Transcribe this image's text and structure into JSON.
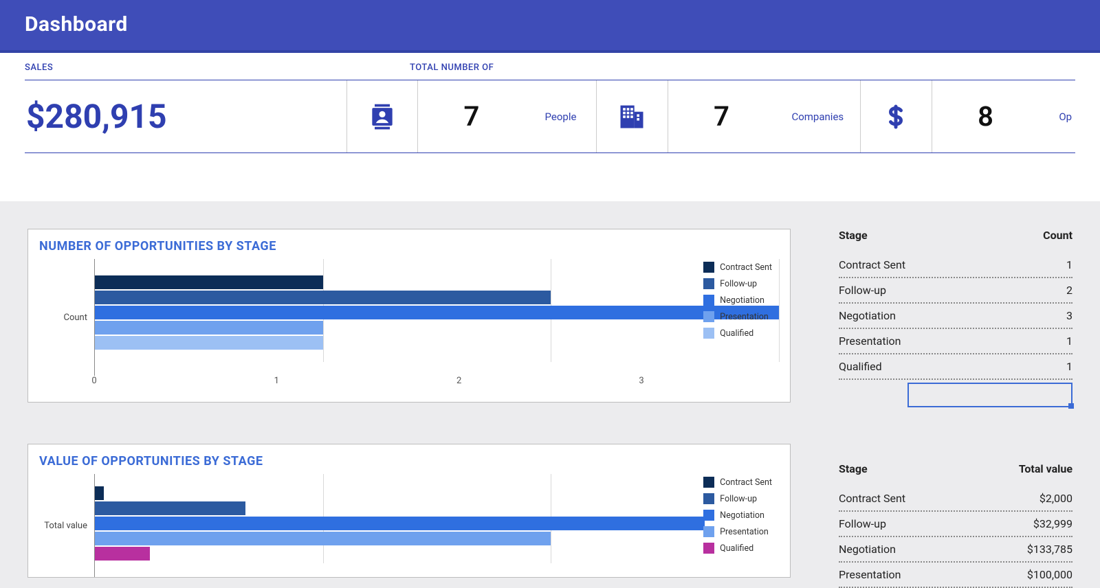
{
  "appbar": {
    "title": "Dashboard"
  },
  "summary": {
    "sales_label": "SALES",
    "total_label": "TOTAL NUMBER OF",
    "sales_value": "$280,915",
    "stats": [
      {
        "icon": "person-badge-icon",
        "value": "7",
        "label": "People"
      },
      {
        "icon": "building-icon",
        "value": "7",
        "label": "Companies"
      },
      {
        "icon": "dollar-icon",
        "value": "8",
        "label": "Op"
      }
    ]
  },
  "charts": {
    "opp_count": {
      "title": "NUMBER OF OPPORTUNITIES BY STAGE",
      "ylabel": "Count",
      "ticks": [
        "0",
        "1",
        "2",
        "3"
      ]
    },
    "opp_value": {
      "title": "VALUE OF OPPORTUNITIES BY STAGE",
      "ylabel": "Total value"
    }
  },
  "opp_count_table": {
    "header_stage": "Stage",
    "header_count": "Count",
    "rows": [
      {
        "stage": "Contract Sent",
        "count": "1"
      },
      {
        "stage": "Follow-up",
        "count": "2"
      },
      {
        "stage": "Negotiation",
        "count": "3"
      },
      {
        "stage": "Presentation",
        "count": "1"
      },
      {
        "stage": "Qualified",
        "count": "1"
      }
    ]
  },
  "opp_value_table": {
    "header_stage": "Stage",
    "header_value": "Total value",
    "rows": [
      {
        "stage": "Contract Sent",
        "value": "$2,000"
      },
      {
        "stage": "Follow-up",
        "value": "$32,999"
      },
      {
        "stage": "Negotiation",
        "value": "$133,785"
      },
      {
        "stage": "Presentation",
        "value": "$100,000"
      }
    ]
  },
  "legend_items": [
    {
      "label": "Contract Sent",
      "color": "#0c2d57"
    },
    {
      "label": "Follow-up",
      "color": "#2c5aa0"
    },
    {
      "label": "Negotiation",
      "color": "#2f6fe0"
    },
    {
      "label": "Presentation",
      "color": "#6fa1ee"
    },
    {
      "label": "Qualified",
      "color": "#9cc0f4"
    }
  ],
  "legend_items_value": [
    {
      "label": "Contract Sent",
      "color": "#0c2d57"
    },
    {
      "label": "Follow-up",
      "color": "#2c5aa0"
    },
    {
      "label": "Negotiation",
      "color": "#2f6fe0"
    },
    {
      "label": "Presentation",
      "color": "#6fa1ee"
    },
    {
      "label": "Qualified",
      "color": "#b8309f"
    }
  ],
  "chart_data": [
    {
      "type": "bar",
      "orientation": "horizontal",
      "title": "NUMBER OF OPPORTUNITIES BY STAGE",
      "xlabel": "",
      "ylabel": "Count",
      "xlim": [
        0,
        3
      ],
      "categories": [
        "Contract Sent",
        "Follow-up",
        "Negotiation",
        "Presentation",
        "Qualified"
      ],
      "values": [
        1,
        2,
        3,
        1,
        1
      ],
      "colors": [
        "#0c2d57",
        "#2c5aa0",
        "#2f6fe0",
        "#6fa1ee",
        "#9cc0f4"
      ]
    },
    {
      "type": "bar",
      "orientation": "horizontal",
      "title": "VALUE OF OPPORTUNITIES BY STAGE",
      "xlabel": "",
      "ylabel": "Total value",
      "xlim": [
        0,
        150000
      ],
      "categories": [
        "Contract Sent",
        "Follow-up",
        "Negotiation",
        "Presentation",
        "Qualified"
      ],
      "values": [
        2000,
        32999,
        133785,
        100000,
        12000
      ],
      "colors": [
        "#0c2d57",
        "#2c5aa0",
        "#2f6fe0",
        "#6fa1ee",
        "#b8309f"
      ]
    }
  ]
}
